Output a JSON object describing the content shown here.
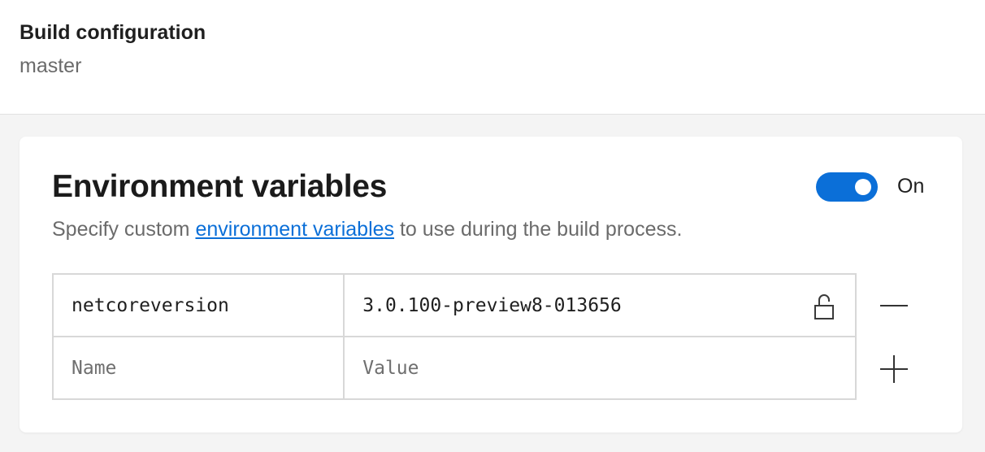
{
  "header": {
    "title": "Build configuration",
    "subtitle": "master"
  },
  "env": {
    "title": "Environment variables",
    "toggle_label": "On",
    "toggle_on": true,
    "accent_color": "#0b6fd8",
    "description_prefix": "Specify custom ",
    "description_link": "environment variables",
    "description_suffix": " to use during the build process.",
    "rows": [
      {
        "name": "netcoreversion",
        "value": "3.0.100-preview8-013656"
      }
    ],
    "new_row": {
      "name_placeholder": "Name",
      "value_placeholder": "Value"
    },
    "icons": {
      "lock": "lock-open-icon",
      "remove": "minus-icon",
      "add": "plus-icon"
    }
  }
}
